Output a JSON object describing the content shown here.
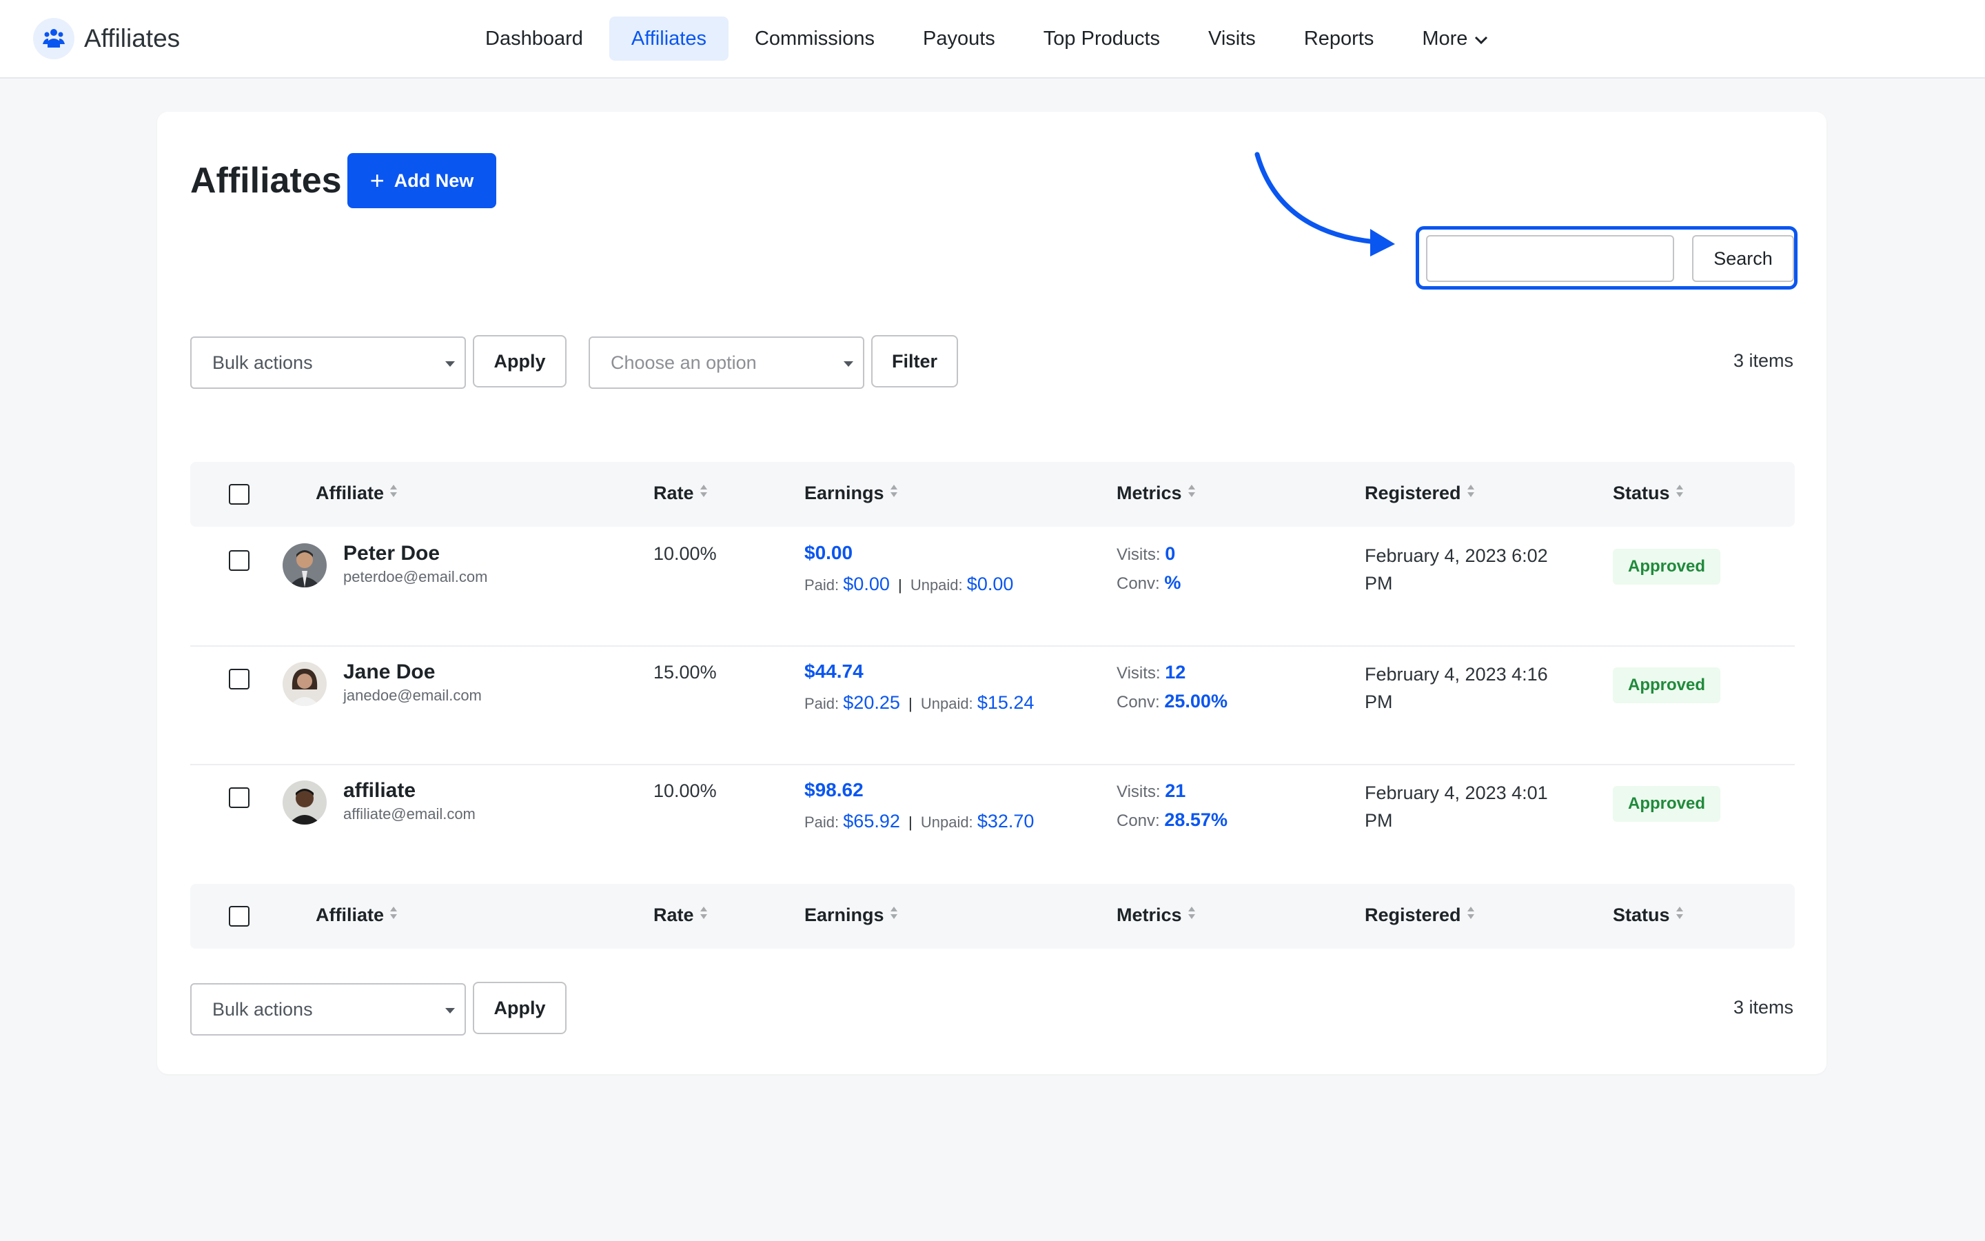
{
  "app": {
    "title": "Affiliates",
    "nav": [
      {
        "label": "Dashboard",
        "active": false
      },
      {
        "label": "Affiliates",
        "active": true
      },
      {
        "label": "Commissions",
        "active": false
      },
      {
        "label": "Payouts",
        "active": false
      },
      {
        "label": "Top Products",
        "active": false
      },
      {
        "label": "Visits",
        "active": false
      },
      {
        "label": "Reports",
        "active": false
      },
      {
        "label": "More",
        "active": false,
        "icon": "chevron-down-icon"
      }
    ],
    "accent_color": "#0a56f0"
  },
  "page": {
    "title": "Affiliates",
    "add_new_label": "Add New",
    "search": {
      "value": "",
      "button_label": "Search"
    },
    "top_controls": {
      "bulk_actions": "Bulk actions",
      "apply_label": "Apply",
      "filter_select": "Choose an option",
      "filter_label": "Filter",
      "count": "3 items"
    },
    "bottom_controls": {
      "bulk_actions": "Bulk actions",
      "apply_label": "Apply",
      "count": "3 items"
    }
  },
  "table": {
    "columns": [
      "Affiliate",
      "Rate",
      "Earnings",
      "Metrics",
      "Registered",
      "Status"
    ],
    "rows": [
      {
        "name": "Peter Doe",
        "email": "peterdoe@email.com",
        "rate": "10.00%",
        "earnings_total": "$0.00",
        "paid_label": "Paid:",
        "paid": "$0.00",
        "unpaid_label": "Unpaid:",
        "unpaid": "$0.00",
        "visits_label": "Visits:",
        "visits": "0",
        "conv_label": "Conv:",
        "conv": "%",
        "registered": "February 4, 2023 6:02 PM",
        "status": "Approved"
      },
      {
        "name": "Jane Doe",
        "email": "janedoe@email.com",
        "rate": "15.00%",
        "earnings_total": "$44.74",
        "paid_label": "Paid:",
        "paid": "$20.25",
        "unpaid_label": "Unpaid:",
        "unpaid": "$15.24",
        "visits_label": "Visits:",
        "visits": "12",
        "conv_label": "Conv:",
        "conv": "25.00%",
        "registered": "February 4, 2023 4:16 PM",
        "status": "Approved"
      },
      {
        "name": "affiliate",
        "email": "affiliate@email.com",
        "rate": "10.00%",
        "earnings_total": "$98.62",
        "paid_label": "Paid:",
        "paid": "$65.92",
        "unpaid_label": "Unpaid:",
        "unpaid": "$32.70",
        "visits_label": "Visits:",
        "visits": "21",
        "conv_label": "Conv:",
        "conv": "28.57%",
        "registered": "February 4, 2023 4:01 PM",
        "status": "Approved"
      }
    ]
  }
}
